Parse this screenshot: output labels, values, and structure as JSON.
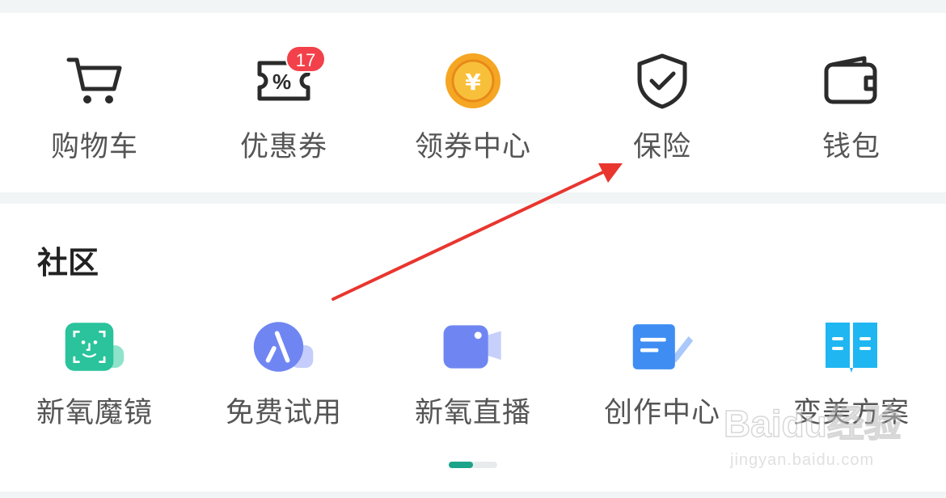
{
  "services": [
    {
      "icon": "shopping-cart-icon",
      "label": "购物车"
    },
    {
      "icon": "coupon-icon",
      "label": "优惠券",
      "badge": "17"
    },
    {
      "icon": "coin-yuan-icon",
      "label": "领券中心",
      "glyph": "¥"
    },
    {
      "icon": "shield-check-icon",
      "label": "保险"
    },
    {
      "icon": "wallet-icon",
      "label": "钱包"
    }
  ],
  "community": {
    "title": "社区",
    "items": [
      {
        "icon": "face-scan-icon",
        "label": "新氧魔镜"
      },
      {
        "icon": "free-trial-icon",
        "label": "免费试用"
      },
      {
        "icon": "live-video-icon",
        "label": "新氧直播"
      },
      {
        "icon": "creator-doc-icon",
        "label": "创作中心"
      },
      {
        "icon": "book-plan-icon",
        "label": "变美方案"
      }
    ],
    "pager": {
      "pages": 2,
      "active": 1
    }
  },
  "watermark": {
    "brand": "Baidu经验",
    "url": "jingyan.baidu.com"
  },
  "colors": {
    "accent": "#1aa48a",
    "badge": "#f2414a",
    "arrow": "#e8362f",
    "label": "#555555",
    "coin": "#f5a623"
  }
}
